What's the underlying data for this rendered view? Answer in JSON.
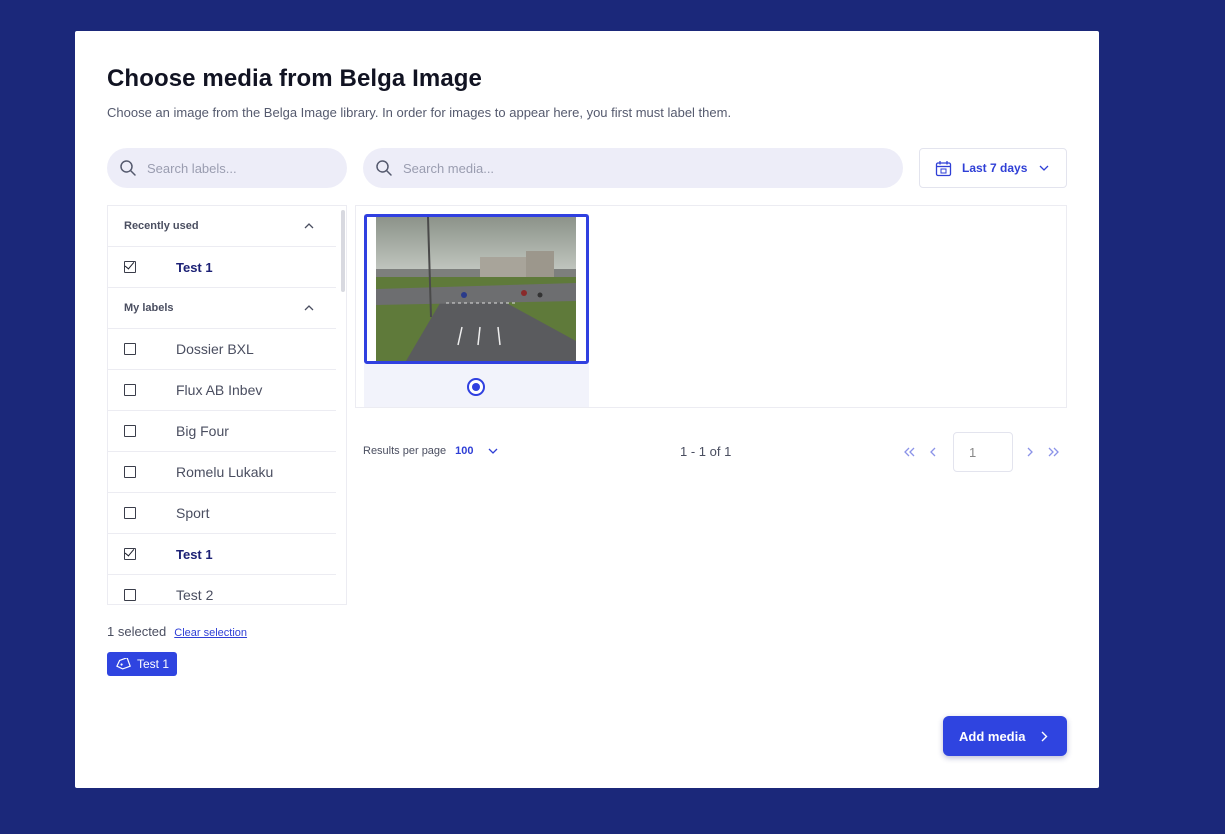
{
  "modal": {
    "title": "Choose media from Belga Image",
    "subtitle": "Choose an image from the Belga Image library. In order for images to appear here, you first must label them."
  },
  "search": {
    "labels_placeholder": "Search labels...",
    "media_placeholder": "Search media..."
  },
  "date_filter": {
    "label": "Last 7 days"
  },
  "labels_panel": {
    "recent_header": "Recently used",
    "recent_items": [
      {
        "label": "Test 1",
        "checked": true
      }
    ],
    "mine_header": "My labels",
    "items": [
      {
        "label": "Dossier BXL",
        "checked": false
      },
      {
        "label": "Flux AB Inbev",
        "checked": false
      },
      {
        "label": "Big Four",
        "checked": false
      },
      {
        "label": "Romelu Lukaku",
        "checked": false
      },
      {
        "label": "Sport",
        "checked": false
      },
      {
        "label": "Test 1",
        "checked": true
      },
      {
        "label": "Test 2",
        "checked": false
      }
    ]
  },
  "pagination": {
    "results_per_page_label": "Results per page",
    "results_per_page_value": "100",
    "range_text": "1 - 1 of 1",
    "current_page": "1"
  },
  "selection": {
    "count_text": "1 selected",
    "clear_label": "Clear selection",
    "chip_label": "Test 1"
  },
  "footer": {
    "add_label": "Add media"
  },
  "colors": {
    "background": "#1b287a",
    "accent": "#2f44e0",
    "search_bg": "#ededf8"
  }
}
